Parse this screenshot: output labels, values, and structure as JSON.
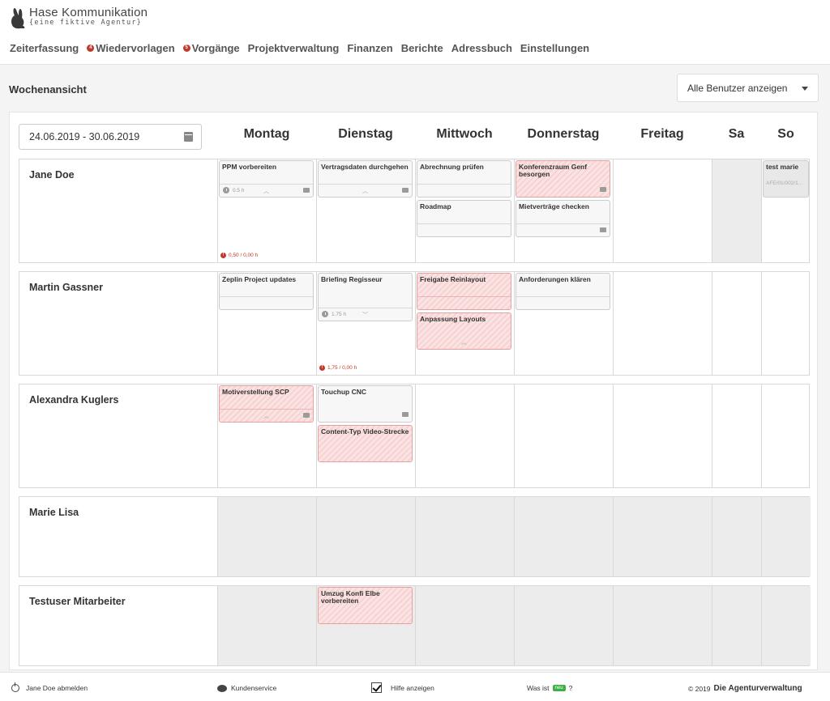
{
  "app": {
    "logo_title": "Hase Kommunikation",
    "logo_subtitle": "{eine fiktive Agentur}"
  },
  "nav": [
    {
      "label": "Zeiterfassung",
      "badge": null
    },
    {
      "label": "Wiedervorlagen",
      "badge": "4"
    },
    {
      "label": "Vorgänge",
      "badge": "5"
    },
    {
      "label": "Projektverwaltung",
      "badge": null
    },
    {
      "label": "Finanzen",
      "badge": null
    },
    {
      "label": "Berichte",
      "badge": null
    },
    {
      "label": "Adressbuch",
      "badge": null
    },
    {
      "label": "Einstellungen",
      "badge": null
    }
  ],
  "page": {
    "title": "Wochenansicht",
    "user_filter": "Alle Benutzer anzeigen",
    "date_range": "24.06.2019 - 30.06.2019"
  },
  "days": [
    "Montag",
    "Dienstag",
    "Mittwoch",
    "Donnerstag",
    "Freitag",
    "Sa",
    "So"
  ],
  "rows": [
    {
      "name": "Jane Doe",
      "tasks": [
        {
          "title": "PPM vorbereiten",
          "hours": "0.5 h"
        },
        {
          "title": "Vertragsdaten durchgehen"
        },
        {
          "title": "Abrechnung prüfen"
        },
        {
          "title": "Roadmap"
        },
        {
          "title": "Konferenzraum Genf besorgen"
        },
        {
          "title": "Mietverträge checken"
        },
        {
          "title": "test marie",
          "sub": "AFE/01/002/1..."
        }
      ],
      "overtime": "0,50 / 0,00 h"
    },
    {
      "name": "Martin Gassner",
      "tasks": [
        {
          "title": "Zeplin Project updates"
        },
        {
          "title": "Briefing Regisseur",
          "hours": "1.75 h"
        },
        {
          "title": "Freigabe Reinlayout"
        },
        {
          "title": "Anpassung Layouts"
        },
        {
          "title": "Anforderungen klären"
        }
      ],
      "overtime": "1,75 / 0,00 h"
    },
    {
      "name": "Alexandra Kuglers",
      "tasks": [
        {
          "title": "Motiverstellung SCP"
        },
        {
          "title": "Touchup CNC"
        },
        {
          "title": "Content-Typ Video-Strecke"
        }
      ]
    },
    {
      "name": "Marie Lisa",
      "tasks": []
    },
    {
      "name": "Testuser Mitarbeiter",
      "tasks": [
        {
          "title": "Umzug Konfi Elbe vorbereiten"
        }
      ]
    }
  ],
  "footer": {
    "logout": "Jane Doe abmelden",
    "support": "Kundenservice",
    "help": "Hilfe anzeigen",
    "whats_new_prefix": "Was ist",
    "whats_new_badge": "neu",
    "whats_new_suffix": "?",
    "copyright": "© 2019",
    "brand": "Die Agenturverwaltung"
  },
  "colors": {
    "overdue_task": "#fbe3e3",
    "badge_red": "#c0392b",
    "neu_green": "#3cb043",
    "weekend_bg": "#ececec"
  }
}
